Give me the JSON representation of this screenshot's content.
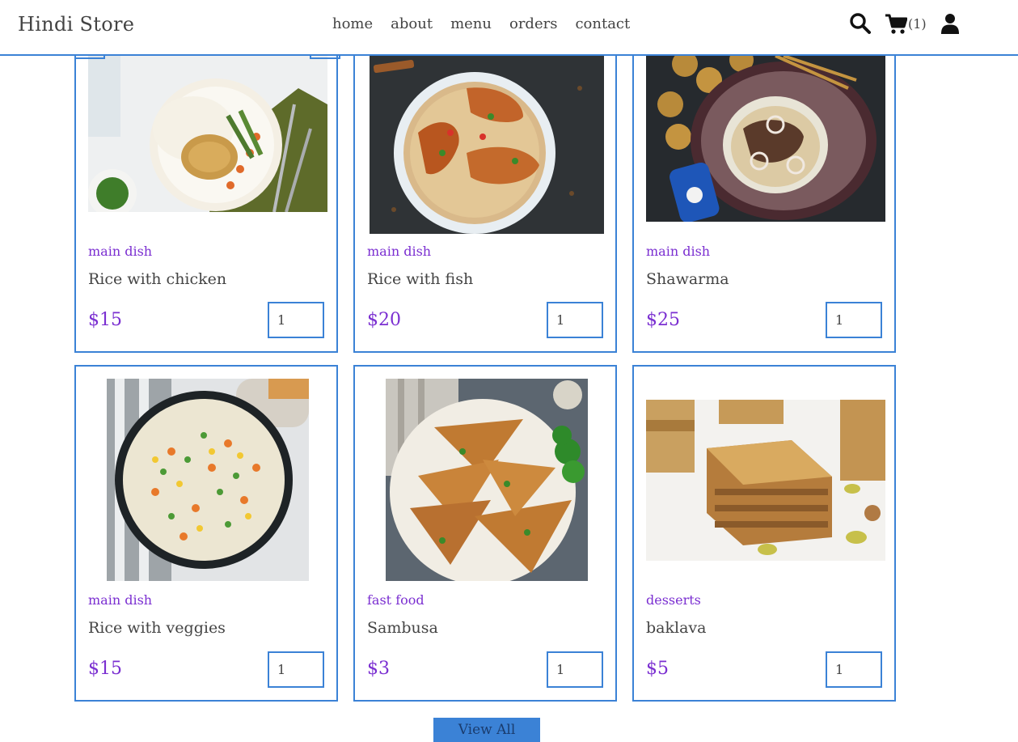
{
  "header": {
    "logo": "Hindi Store",
    "nav": [
      "home",
      "about",
      "menu",
      "orders",
      "contact"
    ],
    "cart_count": "(1)",
    "icons": [
      "search-icon",
      "cart-icon",
      "user-icon"
    ]
  },
  "products": [
    {
      "category": "main dish",
      "name": "Rice with chicken",
      "price": "$15",
      "qty": "1"
    },
    {
      "category": "main dish",
      "name": "Rice with fish",
      "price": "$20",
      "qty": "1"
    },
    {
      "category": "main dish",
      "name": "Shawarma",
      "price": "$25",
      "qty": "1"
    },
    {
      "category": "main dish",
      "name": "Rice with veggies",
      "price": "$15",
      "qty": "1"
    },
    {
      "category": "fast food",
      "name": "Sambusa",
      "price": "$3",
      "qty": "1"
    },
    {
      "category": "desserts",
      "name": "baklava",
      "price": "$5",
      "qty": "1"
    }
  ],
  "view_all_label": "View All",
  "colors": {
    "accent": "#3b82d6",
    "category": "#7b2fd1",
    "text": "#444444"
  }
}
